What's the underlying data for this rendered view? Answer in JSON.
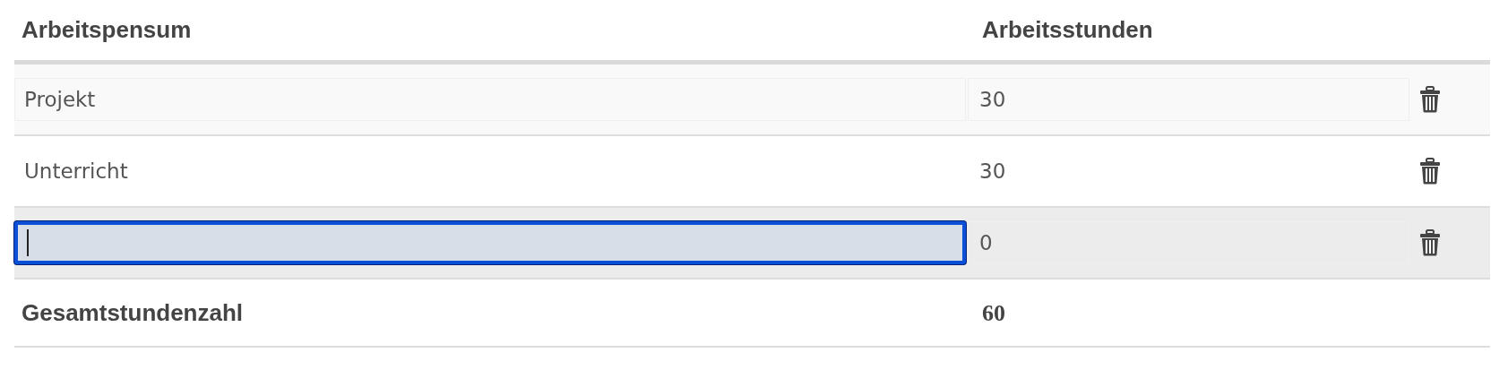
{
  "table": {
    "columns": [
      "Arbeitspensum",
      "Arbeitsstunden"
    ],
    "rows": [
      {
        "name": "Projekt",
        "hours": "30",
        "focused": false,
        "hovered": false
      },
      {
        "name": "Unterricht",
        "hours": "30",
        "focused": false,
        "hovered": false
      },
      {
        "hours": "0",
        "focused": true,
        "hovered": true
      }
    ],
    "total": {
      "label": "Gesamtstundenzahl",
      "value": "60"
    }
  }
}
